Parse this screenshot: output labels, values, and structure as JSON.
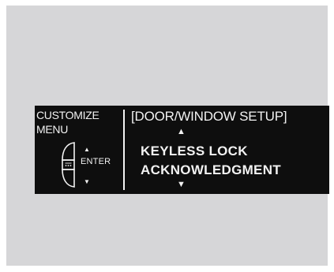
{
  "menu": {
    "title_line1": "CUSTOMIZE",
    "title_line2": "MENU"
  },
  "knob": {
    "enter_label": "ENTER",
    "up_glyph": "▲",
    "down_glyph": "▼",
    "icon": "selector-knob-icon"
  },
  "screen": {
    "section_title": "[DOOR/WINDOW SETUP]",
    "up_arrow": "▲",
    "down_arrow": "▼",
    "item_line1": "KEYLESS LOCK",
    "item_line2": "ACKNOWLEDGMENT"
  },
  "colors": {
    "display_background": "#0e0e0e",
    "display_text": "#f2f2f2",
    "frame_background": "#d6d6d8"
  }
}
